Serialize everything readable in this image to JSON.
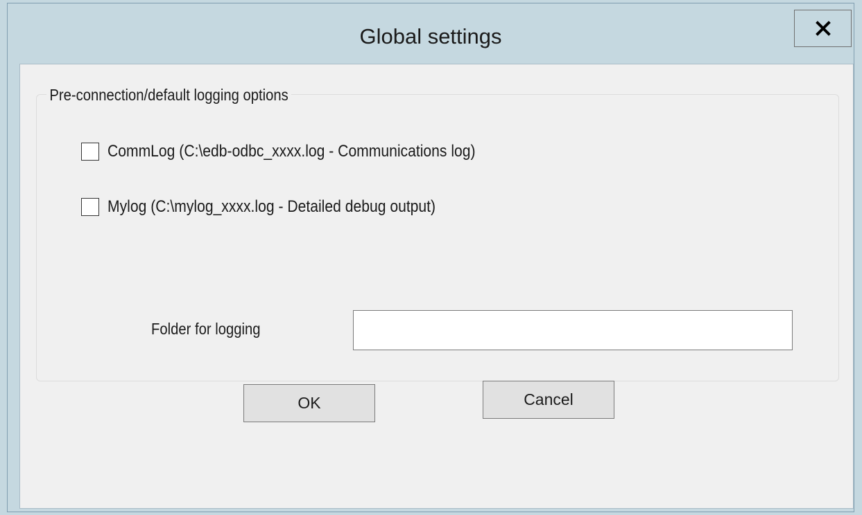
{
  "window": {
    "title": "Global settings"
  },
  "group": {
    "legend": "Pre-connection/default logging options",
    "options": [
      {
        "label": "CommLog (C:\\edb-odbc_xxxx.log - Communications log)",
        "checked": false
      },
      {
        "label": "Mylog (C:\\mylog_xxxx.log - Detailed debug output)",
        "checked": false
      }
    ],
    "folder_label": "Folder for logging",
    "folder_value": ""
  },
  "buttons": {
    "ok": "OK",
    "cancel": "Cancel"
  },
  "icons": {
    "close": "close-icon"
  },
  "colors": {
    "frame": "#c5d8e0",
    "client": "#f0f0f0",
    "button": "#e1e1e1"
  }
}
